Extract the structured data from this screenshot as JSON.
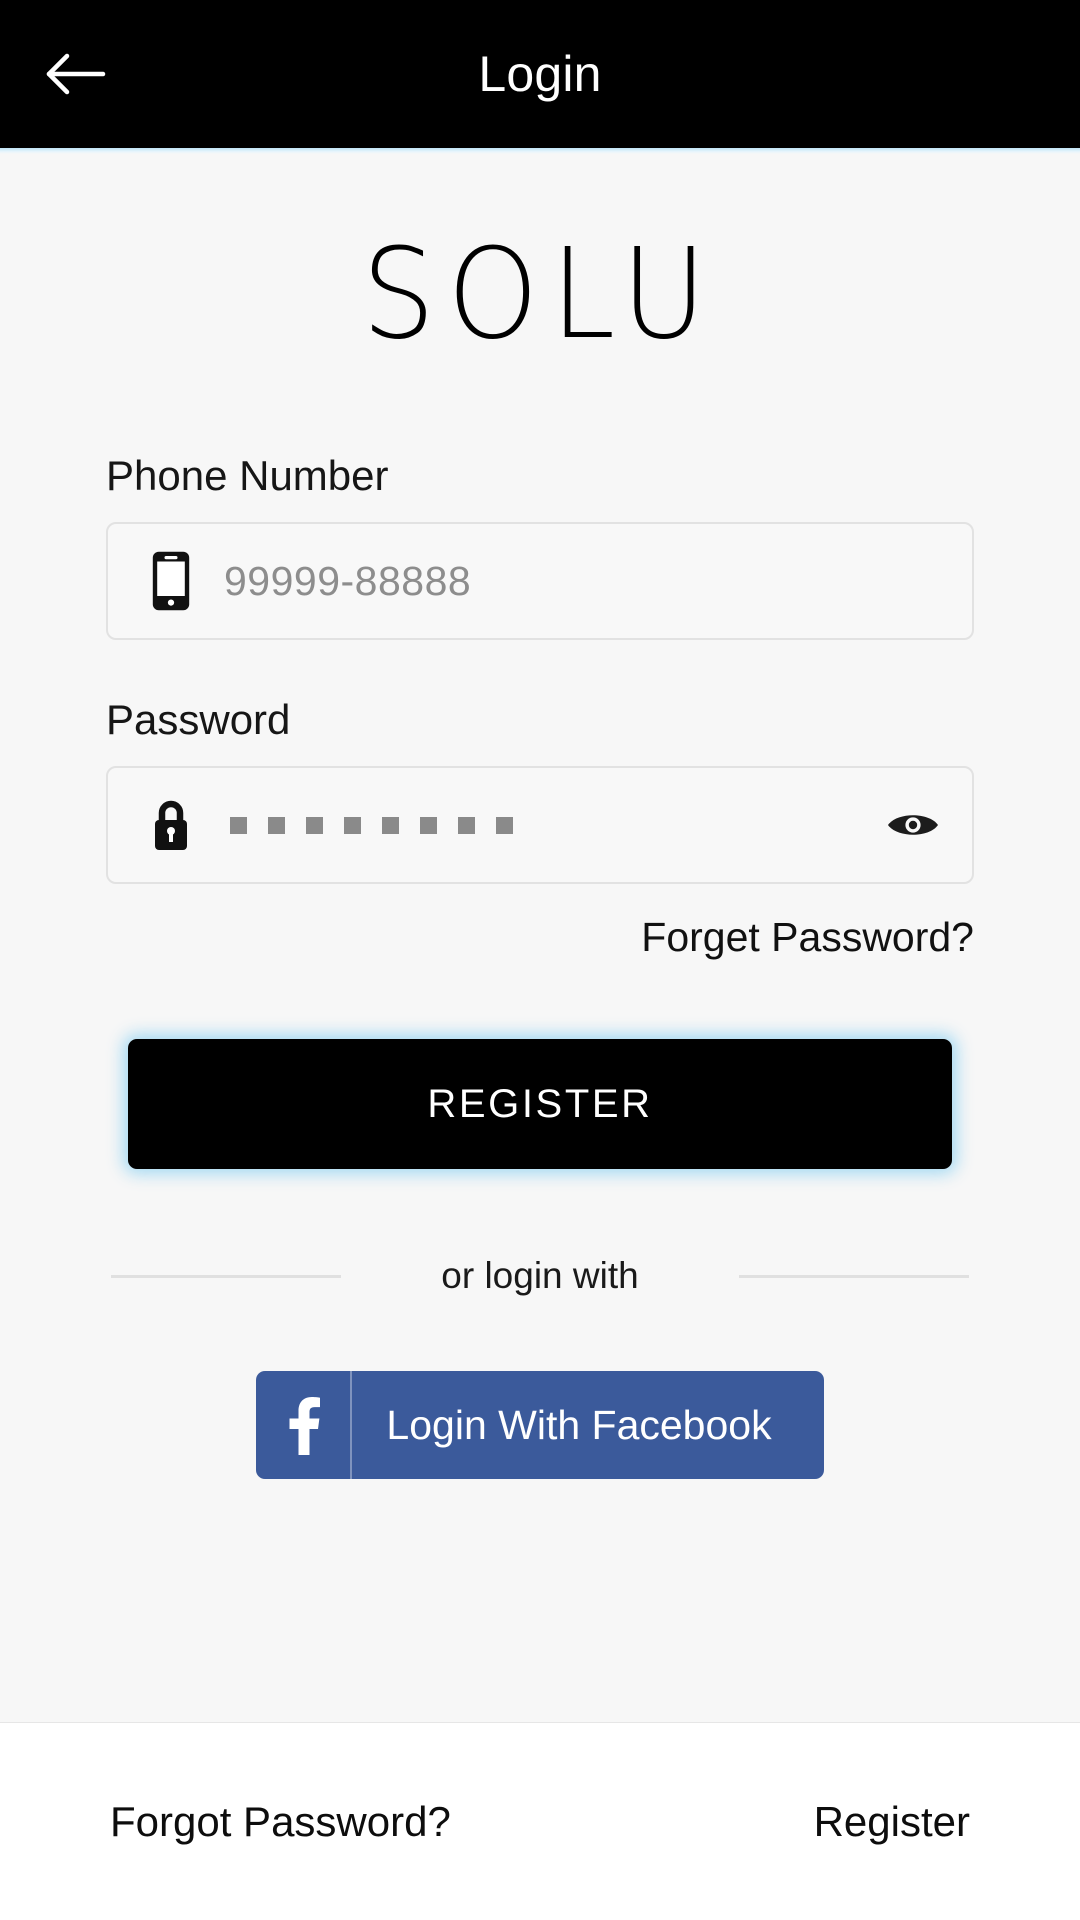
{
  "header": {
    "title": "Login",
    "back_icon": "arrow-left-icon",
    "background_color": "#000000",
    "title_color": "#ffffff",
    "accent_underline_color": "#bfe4f5"
  },
  "brand": {
    "logo_text": "SOLU"
  },
  "form": {
    "phone": {
      "label": "Phone Number",
      "icon": "smartphone-icon",
      "placeholder": "99999-88888",
      "value": ""
    },
    "password": {
      "label": "Password",
      "icon": "lock-icon",
      "masked_char_count": 8,
      "toggle_icon": "eye-icon",
      "value": ""
    },
    "forget_password_link": "Forget Password?"
  },
  "primary_action": {
    "label": "REGISTER",
    "background_color": "#000000",
    "text_color": "#ffffff",
    "glow_color": "#96d5f2"
  },
  "social": {
    "divider_text": "or login with",
    "facebook": {
      "label": "Login With Facebook",
      "icon": "facebook-f-icon",
      "background_color": "#3b5a9b",
      "text_color": "#ffffff"
    }
  },
  "bottom_bar": {
    "forgot_password": "Forgot Password?",
    "register": "Register",
    "background_color": "#ffffff"
  }
}
